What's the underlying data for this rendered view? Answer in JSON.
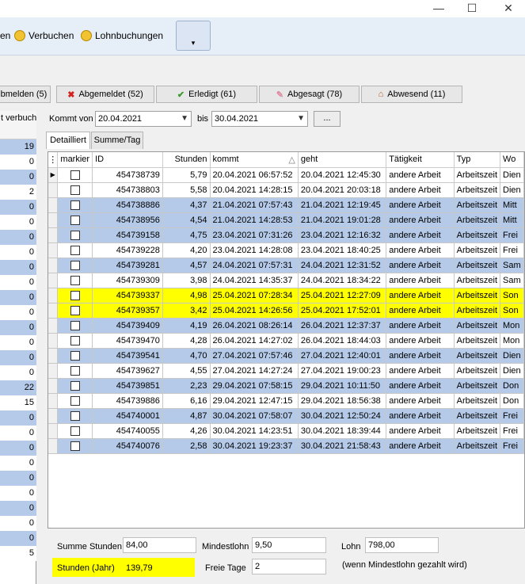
{
  "window": {
    "min_glyph": "—",
    "max_glyph": "☐",
    "close_glyph": "✕"
  },
  "ribbon": {
    "partial_label": "en",
    "verbuchen_label": "Verbuchen",
    "lohnbuchungen_label": "Lohnbuchungen",
    "dropdown_glyph": "▾"
  },
  "tabs": [
    {
      "label": "bmelden (5)",
      "icon": ""
    },
    {
      "label": "Abgemeldet (52)",
      "icon": "✖"
    },
    {
      "label": "Erledigt (61)",
      "icon": "✔"
    },
    {
      "label": "Abgesagt (78)",
      "icon": "✎"
    },
    {
      "label": "Abwesend (11)",
      "icon": "⌂"
    }
  ],
  "left_column": {
    "header": "t verbuch",
    "values": [
      "19",
      "0",
      "0",
      "2",
      "0",
      "0",
      "0",
      "0",
      "0",
      "0",
      "0",
      "0",
      "0",
      "0",
      "0",
      "0",
      "22",
      "15",
      "0",
      "0",
      "0",
      "0",
      "0",
      "0",
      "0",
      "0",
      "0",
      "5"
    ]
  },
  "filter": {
    "kommt_von_label": "Kommt von",
    "date_from": "20.04.2021",
    "bis_label": "bis",
    "date_to": "30.04.2021",
    "dots_label": "..."
  },
  "subtabs": {
    "detailliert": "Detailliert",
    "summe_tag": "Summe/Tag"
  },
  "grid": {
    "columns": [
      "markier",
      "ID",
      "Stunden",
      "kommt",
      "geht",
      "Tätigkeit",
      "Typ",
      "Wo"
    ],
    "sort_glyph": "△",
    "rows": [
      {
        "style": "white",
        "id": "454738739",
        "stunden": "5,79",
        "kommt": "20.04.2021 06:57:52",
        "geht": "20.04.2021 12:45:30",
        "taetigkeit": "andere Arbeit",
        "typ": "Arbeitszeit",
        "wo": "Dien"
      },
      {
        "style": "white",
        "id": "454738803",
        "stunden": "5,58",
        "kommt": "20.04.2021 14:28:15",
        "geht": "20.04.2021 20:03:18",
        "taetigkeit": "andere Arbeit",
        "typ": "Arbeitszeit",
        "wo": "Dien"
      },
      {
        "style": "blue",
        "id": "454738886",
        "stunden": "4,37",
        "kommt": "21.04.2021 07:57:43",
        "geht": "21.04.2021 12:19:45",
        "taetigkeit": "andere Arbeit",
        "typ": "Arbeitszeit",
        "wo": "Mitt"
      },
      {
        "style": "blue",
        "id": "454738956",
        "stunden": "4,54",
        "kommt": "21.04.2021 14:28:53",
        "geht": "21.04.2021 19:01:28",
        "taetigkeit": "andere Arbeit",
        "typ": "Arbeitszeit",
        "wo": "Mitt"
      },
      {
        "style": "blue",
        "id": "454739158",
        "stunden": "4,75",
        "kommt": "23.04.2021 07:31:26",
        "geht": "23.04.2021 12:16:32",
        "taetigkeit": "andere Arbeit",
        "typ": "Arbeitszeit",
        "wo": "Frei"
      },
      {
        "style": "white",
        "id": "454739228",
        "stunden": "4,20",
        "kommt": "23.04.2021 14:28:08",
        "geht": "23.04.2021 18:40:25",
        "taetigkeit": "andere Arbeit",
        "typ": "Arbeitszeit",
        "wo": "Frei"
      },
      {
        "style": "blue",
        "id": "454739281",
        "stunden": "4,57",
        "kommt": "24.04.2021 07:57:31",
        "geht": "24.04.2021 12:31:52",
        "taetigkeit": "andere Arbeit",
        "typ": "Arbeitszeit",
        "wo": "Sam"
      },
      {
        "style": "white",
        "id": "454739309",
        "stunden": "3,98",
        "kommt": "24.04.2021 14:35:37",
        "geht": "24.04.2021 18:34:22",
        "taetigkeit": "andere Arbeit",
        "typ": "Arbeitszeit",
        "wo": "Sam"
      },
      {
        "style": "yellow",
        "id": "454739337",
        "stunden": "4,98",
        "kommt": "25.04.2021 07:28:34",
        "geht": "25.04.2021 12:27:09",
        "taetigkeit": "andere Arbeit",
        "typ": "Arbeitszeit",
        "wo": "Son"
      },
      {
        "style": "yellow",
        "id": "454739357",
        "stunden": "3,42",
        "kommt": "25.04.2021 14:26:56",
        "geht": "25.04.2021 17:52:01",
        "taetigkeit": "andere Arbeit",
        "typ": "Arbeitszeit",
        "wo": "Son"
      },
      {
        "style": "blue",
        "id": "454739409",
        "stunden": "4,19",
        "kommt": "26.04.2021 08:26:14",
        "geht": "26.04.2021 12:37:37",
        "taetigkeit": "andere Arbeit",
        "typ": "Arbeitszeit",
        "wo": "Mon"
      },
      {
        "style": "white",
        "id": "454739470",
        "stunden": "4,28",
        "kommt": "26.04.2021 14:27:02",
        "geht": "26.04.2021 18:44:03",
        "taetigkeit": "andere Arbeit",
        "typ": "Arbeitszeit",
        "wo": "Mon"
      },
      {
        "style": "blue",
        "id": "454739541",
        "stunden": "4,70",
        "kommt": "27.04.2021 07:57:46",
        "geht": "27.04.2021 12:40:01",
        "taetigkeit": "andere Arbeit",
        "typ": "Arbeitszeit",
        "wo": "Dien"
      },
      {
        "style": "white",
        "id": "454739627",
        "stunden": "4,55",
        "kommt": "27.04.2021 14:27:24",
        "geht": "27.04.2021 19:00:23",
        "taetigkeit": "andere Arbeit",
        "typ": "Arbeitszeit",
        "wo": "Dien"
      },
      {
        "style": "blue",
        "id": "454739851",
        "stunden": "2,23",
        "kommt": "29.04.2021 07:58:15",
        "geht": "29.04.2021 10:11:50",
        "taetigkeit": "andere Arbeit",
        "typ": "Arbeitszeit",
        "wo": "Don"
      },
      {
        "style": "white",
        "id": "454739886",
        "stunden": "6,16",
        "kommt": "29.04.2021 12:47:15",
        "geht": "29.04.2021 18:56:38",
        "taetigkeit": "andere Arbeit",
        "typ": "Arbeitszeit",
        "wo": "Don"
      },
      {
        "style": "blue",
        "id": "454740001",
        "stunden": "4,87",
        "kommt": "30.04.2021 07:58:07",
        "geht": "30.04.2021 12:50:24",
        "taetigkeit": "andere Arbeit",
        "typ": "Arbeitszeit",
        "wo": "Frei"
      },
      {
        "style": "white",
        "id": "454740055",
        "stunden": "4,26",
        "kommt": "30.04.2021 14:23:51",
        "geht": "30.04.2021 18:39:44",
        "taetigkeit": "andere Arbeit",
        "typ": "Arbeitszeit",
        "wo": "Frei"
      },
      {
        "style": "blue",
        "id": "454740076",
        "stunden": "2,58",
        "kommt": "30.04.2021 19:23:37",
        "geht": "30.04.2021 21:58:43",
        "taetigkeit": "andere Arbeit",
        "typ": "Arbeitszeit",
        "wo": "Frei"
      }
    ]
  },
  "summary": {
    "summe_stunden_label": "Summe Stunden",
    "summe_stunden_value": "84,00",
    "mindestlohn_label": "Mindestlohn",
    "mindestlohn_value": "9,50",
    "lohn_label": "Lohn",
    "lohn_value": "798,00",
    "stunden_jahr_label": "Stunden (Jahr)",
    "stunden_jahr_value": "139,79",
    "freie_tage_label": "Freie Tage",
    "freie_tage_value": "2",
    "note": "(wenn Mindestlohn gezahlt wird)"
  },
  "colors": {
    "row_blue": "#b5cae8",
    "row_yellow": "#ffff00",
    "ribbon": "#e6eef8"
  }
}
